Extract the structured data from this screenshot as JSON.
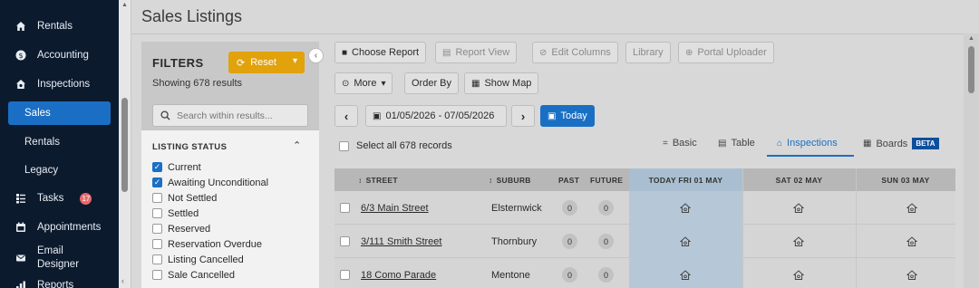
{
  "sidebar": {
    "items": [
      {
        "label": "Rentals",
        "icon": "house-icon"
      },
      {
        "label": "Accounting",
        "icon": "dollar-circle-icon"
      },
      {
        "label": "Inspections",
        "icon": "house-search-icon"
      },
      {
        "label": "Sales",
        "icon": ""
      },
      {
        "label": "Rentals",
        "icon": ""
      },
      {
        "label": "Legacy",
        "icon": ""
      },
      {
        "label": "Tasks",
        "icon": "tasks-icon",
        "badge": "17"
      },
      {
        "label": "Appointments",
        "icon": "calendar-icon"
      },
      {
        "label": "Email Designer",
        "icon": "mail-icon"
      },
      {
        "label": "Reports",
        "icon": "chart-icon"
      }
    ]
  },
  "page": {
    "title": "Sales Listings"
  },
  "filters": {
    "title": "FILTERS",
    "reset_label": "Reset",
    "count_text": "Showing 678 results",
    "search_placeholder": "Search within results...",
    "section_title": "LISTING STATUS",
    "statuses": [
      {
        "label": "Current",
        "checked": true
      },
      {
        "label": "Awaiting Unconditional",
        "checked": true
      },
      {
        "label": "Not Settled",
        "checked": false
      },
      {
        "label": "Settled",
        "checked": false
      },
      {
        "label": "Reserved",
        "checked": false
      },
      {
        "label": "Reservation Overdue",
        "checked": false
      },
      {
        "label": "Listing Cancelled",
        "checked": false
      },
      {
        "label": "Sale Cancelled",
        "checked": false
      }
    ]
  },
  "toolbar": {
    "choose_report": "Choose Report",
    "report_view": "Report View",
    "edit_columns": "Edit Columns",
    "library": "Library",
    "portal_uploader": "Portal Uploader",
    "more": "More",
    "order_by": "Order By",
    "show_map": "Show Map",
    "date_range": "01/05/2026 - 07/05/2026",
    "today": "Today"
  },
  "views": {
    "select_all": "Select all 678 records",
    "basic": "Basic",
    "table": "Table",
    "inspections": "Inspections",
    "boards": "Boards",
    "beta": "BETA"
  },
  "table": {
    "headers": {
      "street": "STREET",
      "suburb": "SUBURB",
      "past": "PAST",
      "future": "FUTURE",
      "today": "TODAY FRI 01 MAY",
      "sat": "SAT 02 MAY",
      "sun": "SUN 03 MAY"
    },
    "rows": [
      {
        "street": "6/3 Main Street",
        "suburb": "Elsternwick",
        "past": "0",
        "future": "0"
      },
      {
        "street": "3/111 Smith Street",
        "suburb": "Thornbury",
        "past": "0",
        "future": "0"
      },
      {
        "street": "18 Como Parade",
        "suburb": "Mentone",
        "past": "0",
        "future": "0"
      }
    ]
  },
  "colors": {
    "accent": "#1a6fc4",
    "reset": "#e1a20c",
    "sidebar": "#0c1a2e",
    "today_col": "#b6c8d8"
  }
}
